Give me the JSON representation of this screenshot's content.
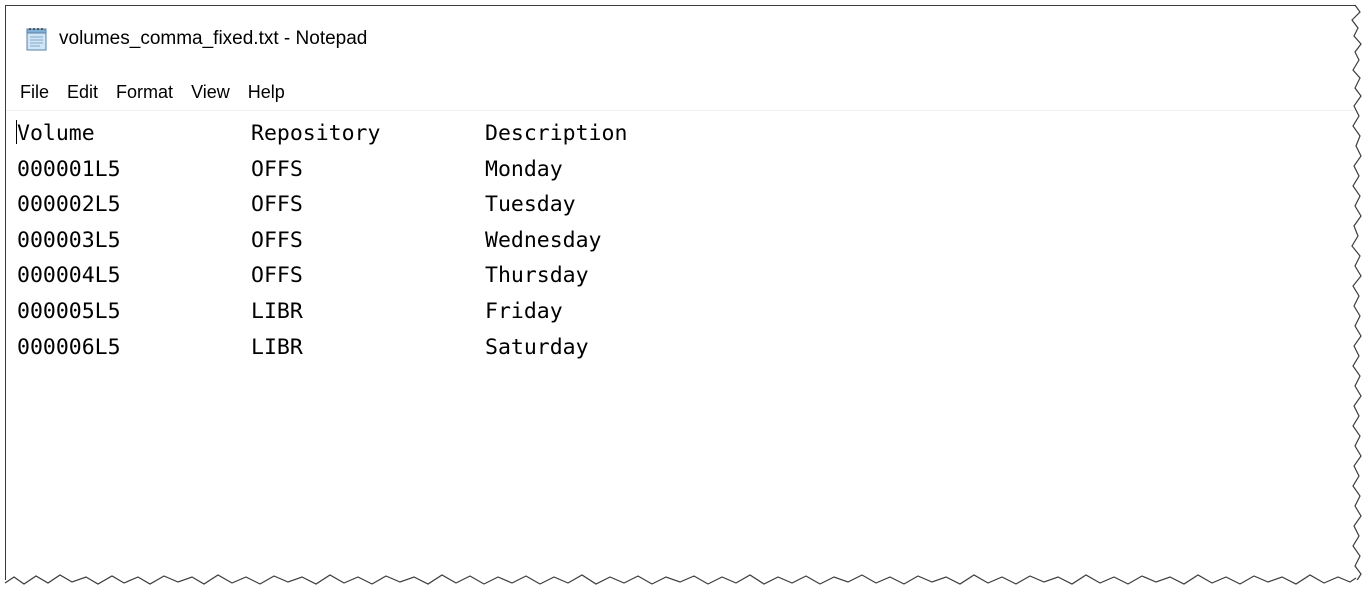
{
  "window": {
    "title": "volumes_comma_fixed.txt - Notepad",
    "app_icon": "notepad-icon"
  },
  "menubar": {
    "items": [
      {
        "label": "File"
      },
      {
        "label": "Edit"
      },
      {
        "label": "Format"
      },
      {
        "label": "View"
      },
      {
        "label": "Help"
      }
    ]
  },
  "editor": {
    "header": {
      "volume": "Volume",
      "repository": "Repository",
      "description": "Description"
    },
    "rows": [
      {
        "volume": "000001L5",
        "repository": "OFFS",
        "description": "Monday"
      },
      {
        "volume": "000002L5",
        "repository": "OFFS",
        "description": "Tuesday"
      },
      {
        "volume": "000003L5",
        "repository": "OFFS",
        "description": "Wednesday"
      },
      {
        "volume": "000004L5",
        "repository": "OFFS",
        "description": "Thursday"
      },
      {
        "volume": "000005L5",
        "repository": "LIBR",
        "description": "Friday"
      },
      {
        "volume": "000006L5",
        "repository": "LIBR",
        "description": "Saturday"
      }
    ]
  },
  "colors": {
    "background": "#ffffff",
    "text": "#000000",
    "border": "#3c3c3c"
  }
}
